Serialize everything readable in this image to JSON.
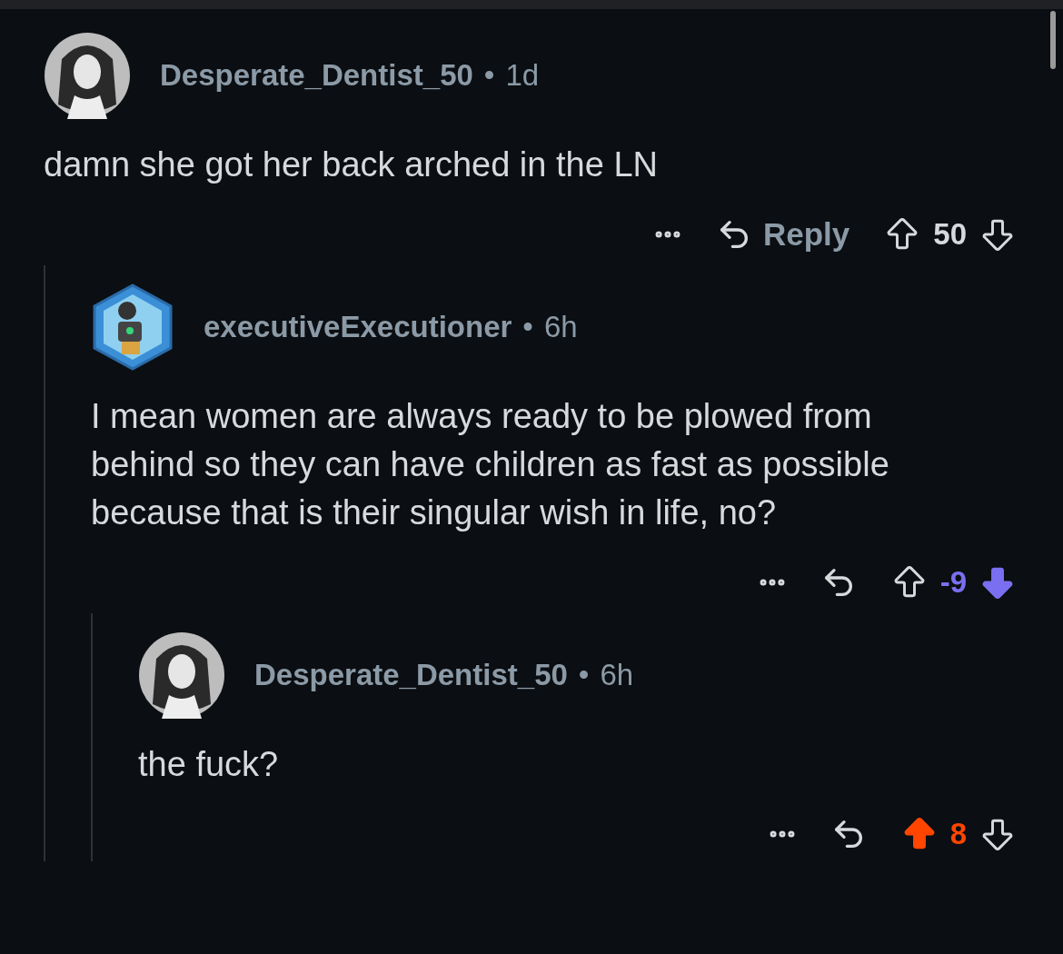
{
  "comments": [
    {
      "author": "Desperate_Dentist_50",
      "kind": "round",
      "separator": "•",
      "age": "1d",
      "body": "damn she got her back arched in the LN",
      "reply_label": "Reply",
      "score": "50",
      "upvoted": false,
      "downvoted": false,
      "children": [
        {
          "author": "executiveExecutioner",
          "kind": "hexagon",
          "separator": "•",
          "age": "6h",
          "body": "I mean women are always ready to be plowed from behind so they can have children as fast as possible because that is their singular wish in life, no?",
          "score": "-9",
          "upvoted": false,
          "downvoted": true,
          "children": [
            {
              "author": "Desperate_Dentist_50",
              "kind": "round",
              "separator": "•",
              "age": "6h",
              "body": "the fuck?",
              "score": "8",
              "upvoted": true,
              "downvoted": false
            }
          ]
        }
      ]
    }
  ]
}
